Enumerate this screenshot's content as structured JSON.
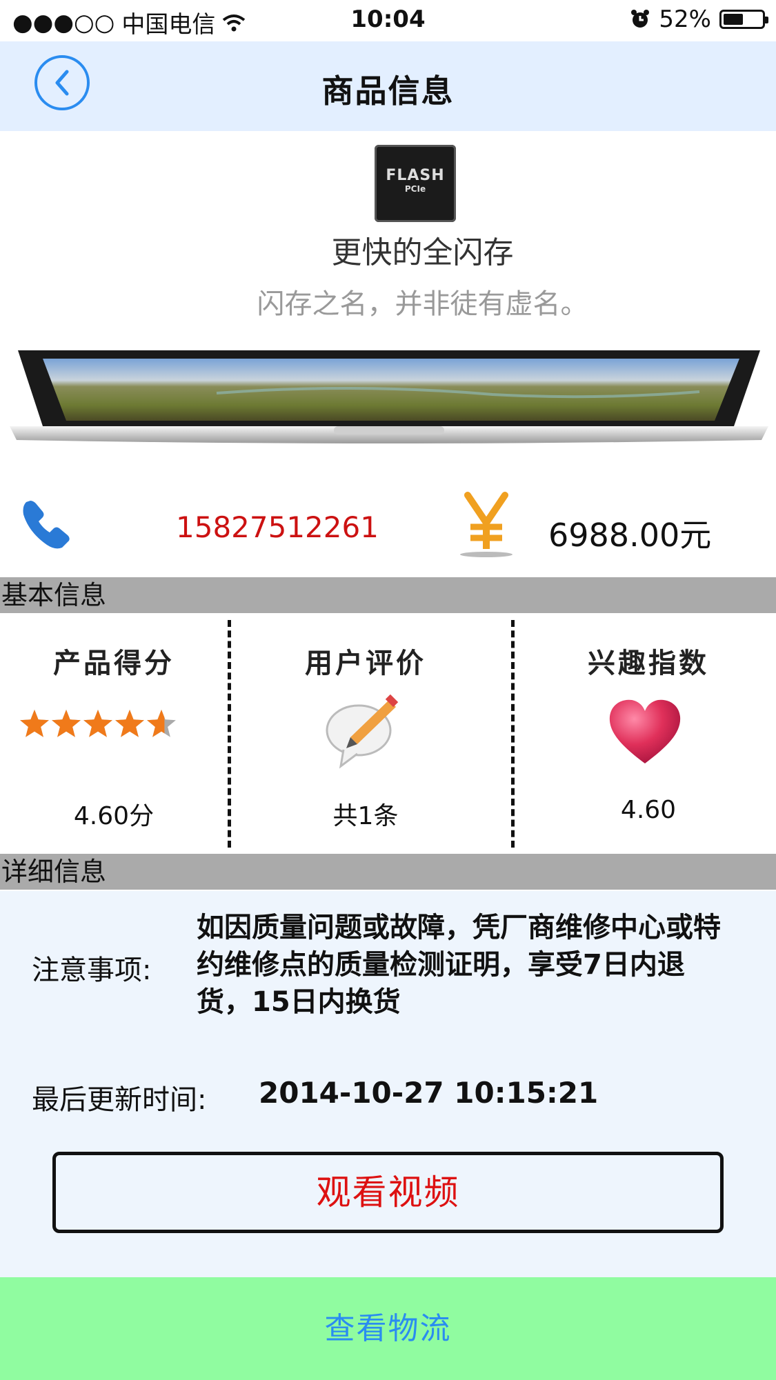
{
  "status_bar": {
    "signal": "●●●○○",
    "carrier": "中国电信",
    "time": "10:04",
    "battery": "52%",
    "battery_level": 0.52
  },
  "nav": {
    "title": "商品信息"
  },
  "banner": {
    "chip_line1": "FLASH",
    "chip_line2": "PCIe",
    "title": "更快的全闪存",
    "subtitle": "闪存之名，并非徒有虚名。"
  },
  "contact": {
    "phone": "15827512261",
    "price": "6988.00元"
  },
  "sections": {
    "basic": "基本信息",
    "detail": "详细信息"
  },
  "cards": [
    {
      "title": "产品得分",
      "value": "4.60分",
      "rating": 4.6,
      "rating_max": 5
    },
    {
      "title": "用户评价",
      "value": "共1条"
    },
    {
      "title": "兴趣指数",
      "value": "4.60"
    }
  ],
  "detail": {
    "notice_label": "注意事项:",
    "notice_text": "如因质量问题或故障，凭厂商维修中心或特约维修点的质量检测证明，享受7日内退货，15日内换货",
    "update_label": "最后更新时间:",
    "update_value": "2014-10-27 10:15:21",
    "video_button": "观看视频"
  },
  "logistics_button": "查看物流",
  "colors": {
    "nav_bg": "#e3efff",
    "section_bg": "#aaaaaa",
    "phone_text": "#cc1111",
    "video_text": "#dd1111",
    "logistics_bg": "#90fca0",
    "logistics_text": "#2a8cf0",
    "star": "#f07a1a"
  }
}
